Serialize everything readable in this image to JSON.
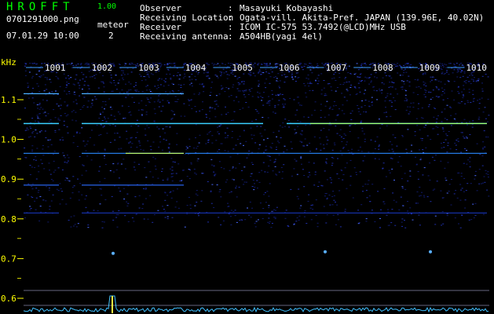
{
  "header": {
    "app_name": "HROFFT",
    "app_version": "1.00",
    "filename": "0701291000.png",
    "datetime": "07.01.29 10:00",
    "meteor_label": "meteor",
    "meteor_count": "2"
  },
  "info": [
    {
      "key": "Observer",
      "value": "Masayuki Kobayashi"
    },
    {
      "key": "Receiving Location",
      "value": "Ogata-vill. Akita-Pref. JAPAN (139.96E, 40.02N)"
    },
    {
      "key": "Receiver",
      "value": "ICOM IC-575 53.7492(@LCD)MHz USB"
    },
    {
      "key": "Receiving antenna",
      "value": "A504HB(yagi 4el)"
    }
  ],
  "axis": {
    "unit": "kHz",
    "ticks": [
      "1.1",
      "1.0",
      "0.9",
      "0.8",
      "0.7",
      "0.6"
    ],
    "tick_values": [
      1.1,
      1.0,
      0.9,
      0.8,
      0.7,
      0.6
    ]
  },
  "time_markers": [
    "1001",
    "1002",
    "1003",
    "1004",
    "1005",
    "1006",
    "1007",
    "1008",
    "1009",
    "1010"
  ],
  "colors": {
    "background": "#000000",
    "text": "#ffffff",
    "accent_text": "#ffff00",
    "title": "#00ff00",
    "noise": "#1a2a9a",
    "carrier": "#3aa8ff"
  }
}
